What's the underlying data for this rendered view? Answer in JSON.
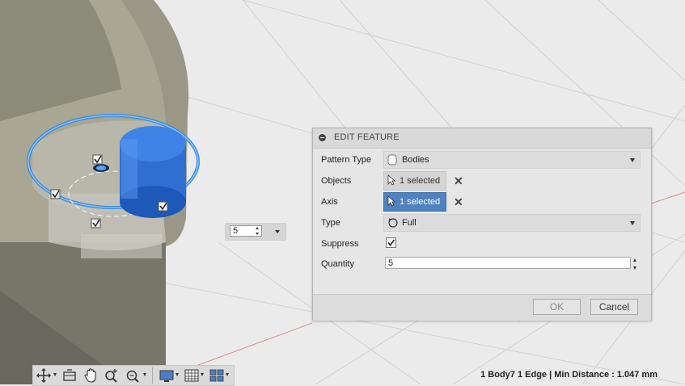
{
  "dialog": {
    "title": "EDIT FEATURE",
    "rows": {
      "pattern_type": {
        "label": "Pattern Type",
        "value": "Bodies"
      },
      "objects": {
        "label": "Objects",
        "value": "1 selected"
      },
      "axis": {
        "label": "Axis",
        "value": "1 selected"
      },
      "type": {
        "label": "Type",
        "value": "Full"
      },
      "suppress": {
        "label": "Suppress",
        "checked": true
      },
      "quantity": {
        "label": "Quantity",
        "value": "5"
      }
    },
    "ok_label": "OK",
    "cancel_label": "Cancel"
  },
  "canvas_spinner": {
    "value": "5"
  },
  "status_bar": {
    "text": "1 Body7 1 Edge | Min Distance : 1.047 mm"
  },
  "toolbar": {
    "icons": [
      "orbit-icon",
      "look-at-icon",
      "pan-icon",
      "zoom-icon",
      "fit-icon",
      "display-settings-icon",
      "grid-icon",
      "viewports-icon"
    ]
  },
  "colors": {
    "selection_blue": "#4a86e8",
    "active_button": "#4f82bf",
    "body_gray": "#8f8c7d"
  }
}
